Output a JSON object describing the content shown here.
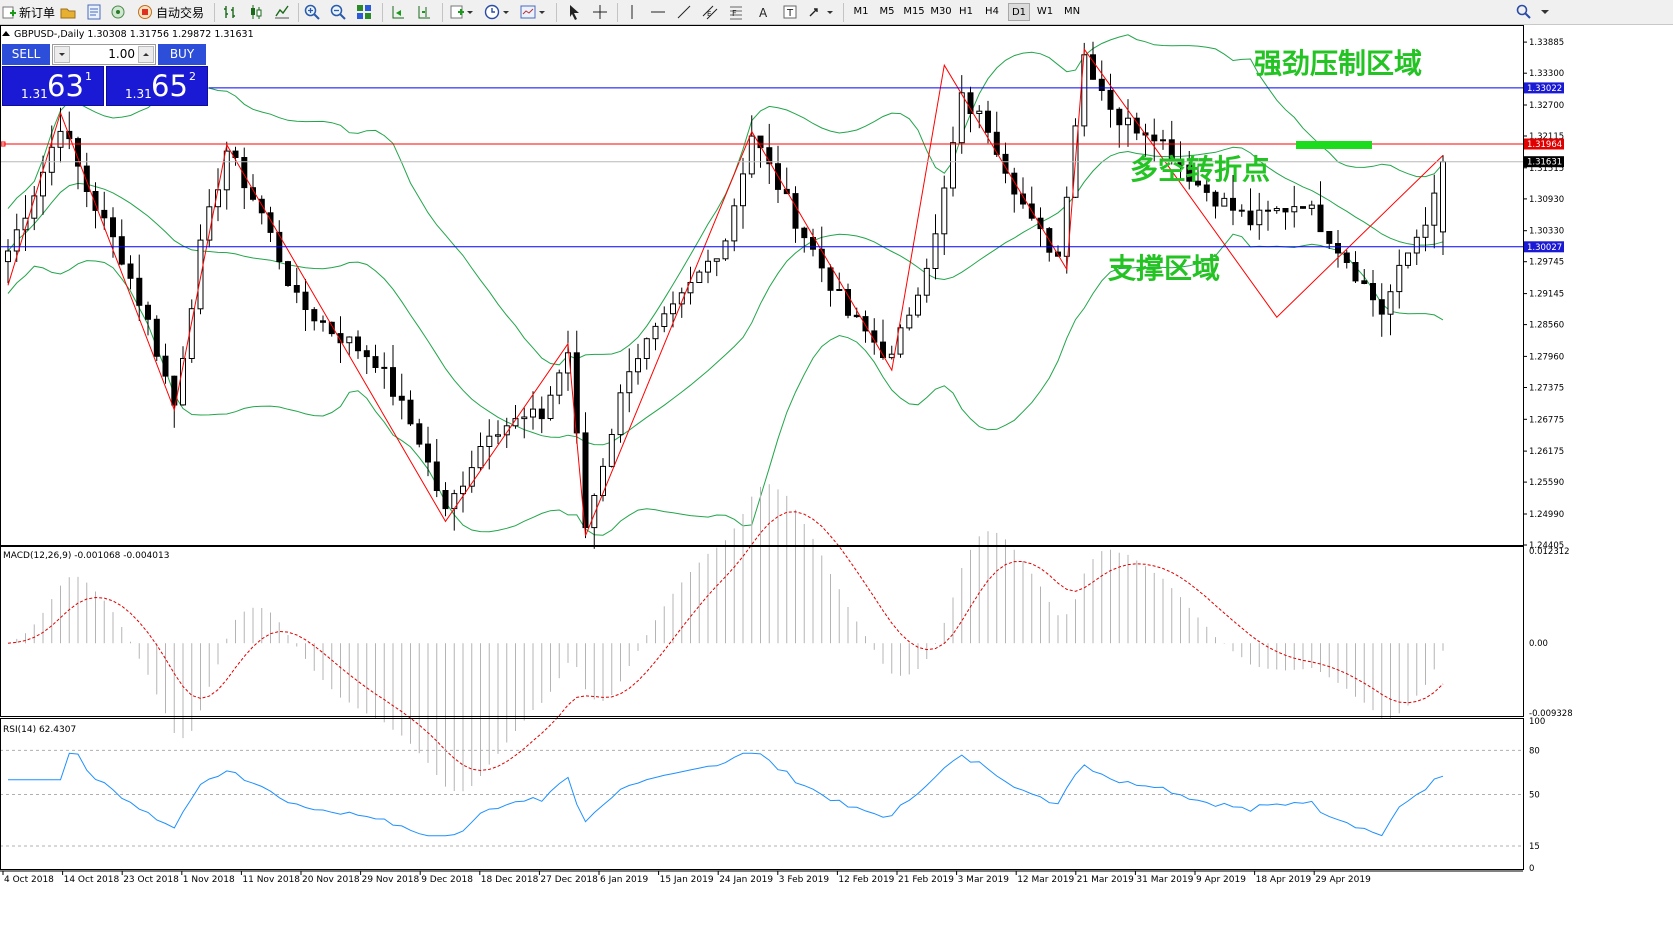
{
  "toolbar": {
    "new_order_label": "新订单",
    "auto_trading_label": "自动交易",
    "timeframes": [
      "M1",
      "M5",
      "M15",
      "M30",
      "H1",
      "H4",
      "D1",
      "W1",
      "MN"
    ],
    "active_timeframe": "D1"
  },
  "chart": {
    "header": "GBPUSD-,Daily  1.30308 1.31756 1.29872 1.31631",
    "price_axis": [
      "1.33885",
      "1.33300",
      "1.32700",
      "1.32115",
      "1.31515",
      "1.30930",
      "1.30330",
      "1.29745",
      "1.29145",
      "1.28560",
      "1.27960",
      "1.27375",
      "1.26775",
      "1.26175",
      "1.25590",
      "1.24990",
      "1.24405"
    ],
    "date_axis": [
      "4 Oct 2018",
      "14 Oct 2018",
      "23 Oct 2018",
      "1 Nov 2018",
      "11 Nov 2018",
      "20 Nov 2018",
      "29 Nov 2018",
      "9 Dec 2018",
      "18 Dec 2018",
      "27 Dec 2018",
      "6 Jan 2019",
      "15 Jan 2019",
      "24 Jan 2019",
      "3 Feb 2019",
      "12 Feb 2019",
      "21 Feb 2019",
      "3 Mar 2019",
      "12 Mar 2019",
      "21 Mar 2019",
      "31 Mar 2019",
      "9 Apr 2019",
      "18 Apr 2019",
      "29 Apr 2019"
    ],
    "levels": {
      "resistance": "1.33022",
      "pivot": "1.31964",
      "current": "1.31631",
      "support": "1.30027"
    },
    "colors": {
      "resistance_line": "#0000ff",
      "pivot_line": "#ff0000",
      "support_line": "#0000ff",
      "bollinger": "#22a54a",
      "zigzag": "#ff0000",
      "annotation": "#22c322",
      "price_bar_text": "#ffffff"
    },
    "annotations": {
      "resistance_zone": "强劲压制区域",
      "turning_point": "多空转折点",
      "support_zone": "支撑区域"
    }
  },
  "one_click": {
    "sell_label": "SELL",
    "buy_label": "BUY",
    "lot": "1.00",
    "sell_base": "1.31",
    "sell_big": "63",
    "sell_sup": "1",
    "buy_base": "1.31",
    "buy_big": "65",
    "buy_sup": "2"
  },
  "macd": {
    "title": "MACD(12,26,9) -0.001068 -0.004013",
    "axis": [
      "0.012312",
      "0.00",
      "-0.009328"
    ]
  },
  "rsi": {
    "title": "RSI(14) 62.4307",
    "axis": [
      "100",
      "80",
      "50",
      "15",
      "0"
    ]
  }
}
